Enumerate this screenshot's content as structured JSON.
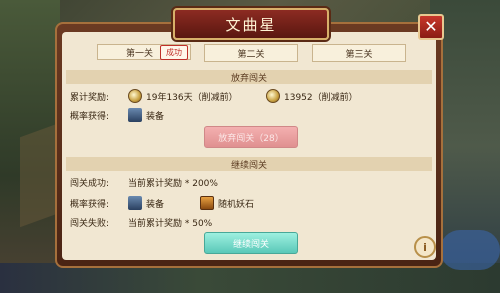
{
  "dialog": {
    "title": "文曲星",
    "close_label": "✕",
    "tabs": [
      {
        "label": "第一关",
        "badge": "成功"
      },
      {
        "label": "第二关"
      },
      {
        "label": "第三关"
      }
    ],
    "abandon_section": {
      "header": "放弃闯关",
      "reward_label": "累计奖励:",
      "reward1": "19年136天（削减前）",
      "reward2": "13952（削减前）",
      "chance_label": "概率获得:",
      "chance_item": "装备",
      "button_label": "放弃闯关（28）"
    },
    "continue_section": {
      "header": "继续闯关",
      "success_label": "闯关成功:",
      "success_text": "当前累计奖励 * 200%",
      "chance_label": "概率获得:",
      "chance_item1": "装备",
      "chance_item2": "随机妖石",
      "fail_label": "闯关失败:",
      "fail_text": "当前累计奖励 * 50%",
      "button_label": "继续闯关"
    },
    "info_label": "i"
  }
}
